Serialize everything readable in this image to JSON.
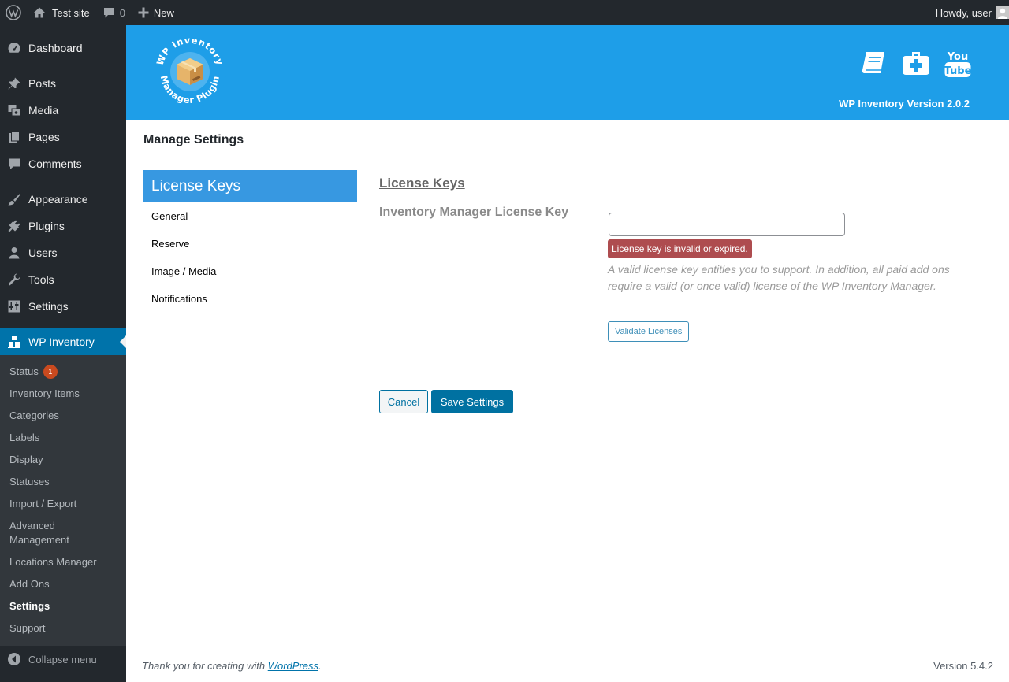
{
  "adminbar": {
    "site_name": "Test site",
    "comment_count": "0",
    "new_label": "New",
    "howdy": "Howdy, user"
  },
  "sidebar": {
    "items": [
      {
        "label": "Dashboard",
        "icon": "dashboard-icon"
      },
      {
        "label": "Posts",
        "icon": "pin-icon"
      },
      {
        "label": "Media",
        "icon": "media-icon"
      },
      {
        "label": "Pages",
        "icon": "pages-icon"
      },
      {
        "label": "Comments",
        "icon": "comment-icon"
      },
      {
        "label": "Appearance",
        "icon": "brush-icon"
      },
      {
        "label": "Plugins",
        "icon": "plug-icon"
      },
      {
        "label": "Users",
        "icon": "user-icon"
      },
      {
        "label": "Tools",
        "icon": "wrench-icon"
      },
      {
        "label": "Settings",
        "icon": "sliders-icon"
      },
      {
        "label": "WP Inventory",
        "icon": "boxes-icon"
      }
    ],
    "submenu": [
      {
        "label": "Status",
        "badge": "1"
      },
      {
        "label": "Inventory Items"
      },
      {
        "label": "Categories"
      },
      {
        "label": "Labels"
      },
      {
        "label": "Display"
      },
      {
        "label": "Statuses"
      },
      {
        "label": "Import / Export"
      },
      {
        "label": "Advanced Management"
      },
      {
        "label": "Locations Manager"
      },
      {
        "label": "Add Ons"
      },
      {
        "label": "Settings"
      },
      {
        "label": "Support"
      }
    ],
    "collapse_label": "Collapse menu"
  },
  "banner": {
    "version": "WP Inventory Version 2.0.2",
    "logo_text": "WP Inventory Manager Plugin",
    "youtube_label_1": "You",
    "youtube_label_2": "Tube",
    "brand_color": "#1e9ee8"
  },
  "main": {
    "page_title": "Manage Settings",
    "tabs": {
      "active": "License Keys",
      "items": [
        "General",
        "Reserve",
        "Image / Media",
        "Notifications"
      ]
    },
    "section_title": "License Keys",
    "field_label": "Inventory Manager License Key",
    "license_value": "",
    "error": "License key is invalid or expired.",
    "help": "A valid license key entitles you to support. In addition, all paid add ons require a valid (or once valid) license of the WP Inventory Manager.",
    "validate_label": "Validate Licenses",
    "cancel_label": "Cancel",
    "save_label": "Save Settings"
  },
  "footer": {
    "thanks_prefix": "Thank you for creating with ",
    "thanks_link": "WordPress",
    "thanks_suffix": ".",
    "version": "Version 5.4.2"
  }
}
